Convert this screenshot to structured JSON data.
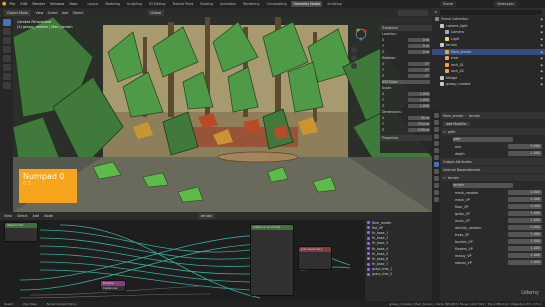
{
  "menu": [
    "File",
    "Edit",
    "Render",
    "Window",
    "Help"
  ],
  "workspace_tabs": [
    "Layout",
    "Modeling",
    "Sculpting",
    "UV Editing",
    "Texture Paint",
    "Shading",
    "Animation",
    "Rendering",
    "Compositing",
    "Geometry Nodes",
    "Scripting"
  ],
  "active_tab": "Geometry Nodes",
  "scene": "Scene",
  "view_layer": "ViewLayer",
  "viewport_header": {
    "mode": "Object Mode",
    "view": "View",
    "select": "Select",
    "add": "Add",
    "object": "Object",
    "orientation": "Global"
  },
  "viewport_overlay": {
    "line1": "Camera Perspective",
    "line2": "(2) grassy_models | Main_terrain"
  },
  "npanel": {
    "section_transform": "Transform",
    "section_properties": "Properties",
    "location_label": "Location:",
    "loc_x": "0 m",
    "loc_y": "0 m",
    "loc_z": "0 m",
    "rotation_label": "Rotation:",
    "rot_x": "0°",
    "rot_y": "0°",
    "rot_z": "0°",
    "mode": "XYZ Euler",
    "scale_label": "Scale:",
    "scale_x": "1.000",
    "scale_y": "1.000",
    "scale_z": "1.000",
    "dim_label": "Dimensions:",
    "dim_x": "50 m",
    "dim_y": "70.0 m",
    "dim_z": "0.55 m"
  },
  "numpad": {
    "title": "Numpad 0",
    "sub": "0.3"
  },
  "node_header": {
    "view": "View",
    "select": "Select",
    "add": "Add",
    "node": "Node",
    "tree": "terrain"
  },
  "attr_items": [
    "floor_render",
    "flat_VP",
    "fir_base_1",
    "fir_base_2",
    "fir_base_3",
    "fir_base_4",
    "fir_base_5",
    "fir_base_6",
    "fir_base_7",
    "grass_tree_1",
    "grass_tree_2"
  ],
  "nodes": {
    "n1": "Object Info",
    "n2": "Instance on Points",
    "n3": "Join Geometry",
    "n4": "Realize Instances"
  },
  "statusbar": {
    "select": "Select",
    "pan": "Pan View",
    "ctx": "Node Context Menu",
    "right": "grassy_models | Main_terrain | Verts 395,983 | Faces 1,217,301 | Tris 2,380,112 | Objects 1/37 | 3.5.1"
  },
  "outliner": {
    "search": "",
    "items": [
      {
        "name": "Scene Collection",
        "level": 0,
        "sel": false
      },
      {
        "name": "camera_light",
        "level": 1,
        "sel": false
      },
      {
        "name": "Camera",
        "level": 2,
        "sel": false
      },
      {
        "name": "Light",
        "level": 2,
        "sel": false
      },
      {
        "name": "terrain",
        "level": 1,
        "sel": false
      },
      {
        "name": "Main_terrain",
        "level": 2,
        "sel": true
      },
      {
        "name": "river",
        "level": 2,
        "sel": false
      },
      {
        "name": "rock_01",
        "level": 2,
        "sel": false
      },
      {
        "name": "rock_02",
        "level": 2,
        "sel": false
      },
      {
        "name": "foliage",
        "level": 1,
        "sel": false
      },
      {
        "name": "grassy_models",
        "level": 1,
        "sel": false
      }
    ]
  },
  "props": {
    "object": "Main_terrain",
    "modifier_header": "terrain",
    "add_modifier": "Add Modifier",
    "mod1": "path",
    "mod1_sub": "path",
    "mod1_rows": [
      {
        "label": "mix",
        "value": "0.000"
      },
      {
        "label": "depth",
        "value": "1.000"
      }
    ],
    "output_attr": "Output Attributes",
    "internal_dep": "Internal Dependencies",
    "mod2": "terrain",
    "mod2_sub": "terrain",
    "mod2_rows": [
      {
        "label": "mask_random",
        "value": "0.000"
      },
      {
        "label": "mask_VP",
        "value": "1.000"
      },
      {
        "label": "floor_VP",
        "value": "0.400"
      },
      {
        "label": "grass_VP",
        "value": "1.000"
      },
      {
        "label": "rocks_VP",
        "value": "1.000"
      },
      {
        "label": "density_random",
        "value": "0.000"
      },
      {
        "label": "trees_VP",
        "value": "1.000"
      },
      {
        "label": "bushes_VP",
        "value": "1.000"
      },
      {
        "label": "flowers_VP",
        "value": "1.000"
      },
      {
        "label": "mossy_VP",
        "value": "1.000"
      },
      {
        "label": "stones_VP",
        "value": "1.000"
      }
    ]
  },
  "colors": {
    "accent": "#4772b3",
    "numpad": "#f5a41b",
    "forest": "#3f7a3a",
    "leaf": "#4f9a46",
    "ground": "#a6966e"
  },
  "watermark": "Udemy"
}
